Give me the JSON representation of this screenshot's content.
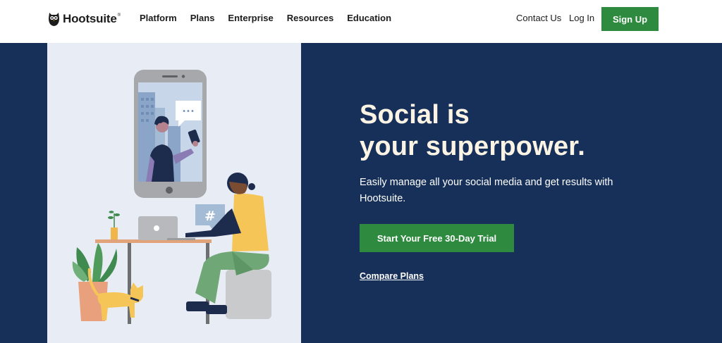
{
  "header": {
    "logo_text": "Hootsuite",
    "logo_mark": "®",
    "nav": [
      "Platform",
      "Plans",
      "Enterprise",
      "Resources",
      "Education"
    ],
    "contact": "Contact Us",
    "login": "Log In",
    "signup": "Sign Up"
  },
  "hero": {
    "headline_line1": "Social is",
    "headline_line2": "your superpower.",
    "subtext": "Easily manage all your social media and get results with Hootsuite.",
    "cta": "Start Your Free 30-Day Trial",
    "compare": "Compare Plans",
    "speech_dots": "•••",
    "hashtag": "#"
  },
  "colors": {
    "brand_green": "#2d8a3e",
    "hero_navy": "#16305a",
    "headline_cream": "#fbf3e4",
    "illustration_bg": "#e8edf5"
  },
  "icons": [
    "owl-logo-icon",
    "phone-icon",
    "laptop-icon",
    "plant-icon",
    "cat-icon",
    "hashtag-bubble-icon",
    "speech-bubble-icon"
  ]
}
